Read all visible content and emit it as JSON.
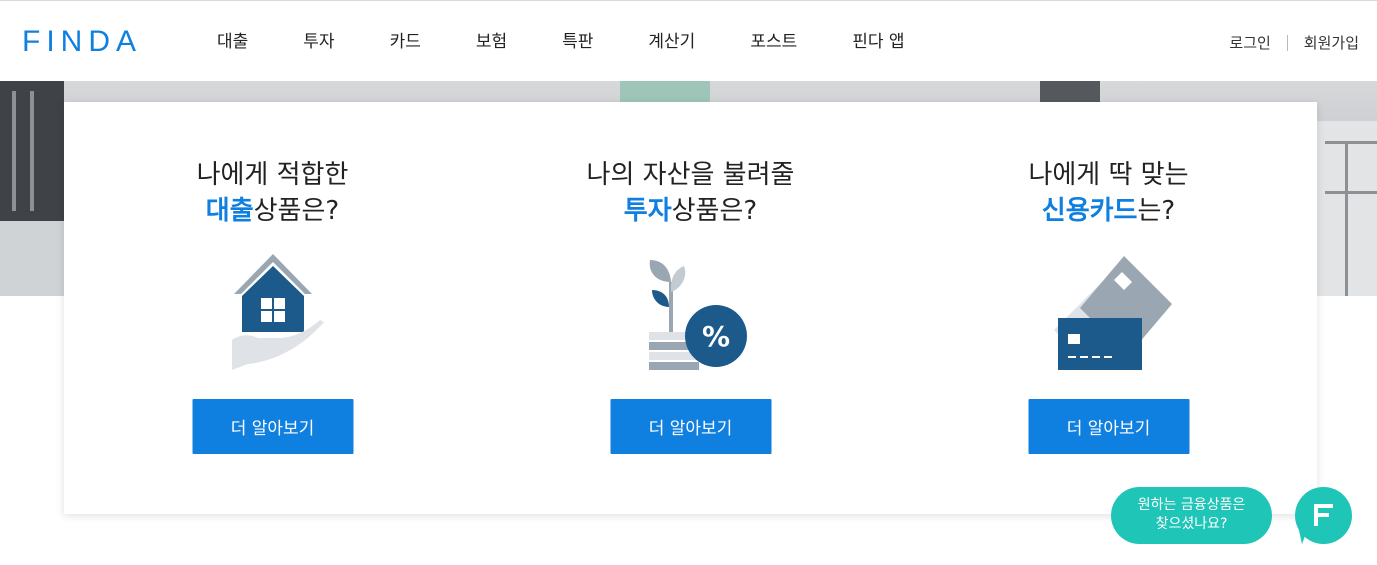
{
  "header": {
    "logo": "FINDA",
    "nav": [
      {
        "label": "대출",
        "name": "nav-loan"
      },
      {
        "label": "투자",
        "name": "nav-invest"
      },
      {
        "label": "카드",
        "name": "nav-card"
      },
      {
        "label": "보험",
        "name": "nav-insurance"
      },
      {
        "label": "특판",
        "name": "nav-special"
      },
      {
        "label": "계산기",
        "name": "nav-calculator"
      },
      {
        "label": "포스트",
        "name": "nav-post"
      },
      {
        "label": "핀다 앱",
        "name": "nav-app"
      }
    ],
    "login": "로그인",
    "signup": "회원가입"
  },
  "cards": [
    {
      "line1": "나에게 적합한",
      "highlight": "대출",
      "rest": "상품은?",
      "icon": "house-in-hand-icon",
      "button": "더 알아보기"
    },
    {
      "line1": "나의 자산을 불려줄",
      "highlight": "투자",
      "rest": "상품은?",
      "icon": "plant-coins-percent-icon",
      "button": "더 알아보기"
    },
    {
      "line1": "나에게 딱 맞는",
      "highlight": "신용카드",
      "rest": "는?",
      "icon": "credit-cards-icon",
      "button": "더 알아보기"
    }
  ],
  "chat": {
    "line1": "원하는 금융상품은",
    "line2": "찾으셨나요?",
    "fab_icon": "finda-f-icon"
  },
  "colors": {
    "brand": "#0f7fe0",
    "chat": "#1fc6b8",
    "icon_dark": "#1d5a8c",
    "icon_gray": "#9aa6b2"
  }
}
